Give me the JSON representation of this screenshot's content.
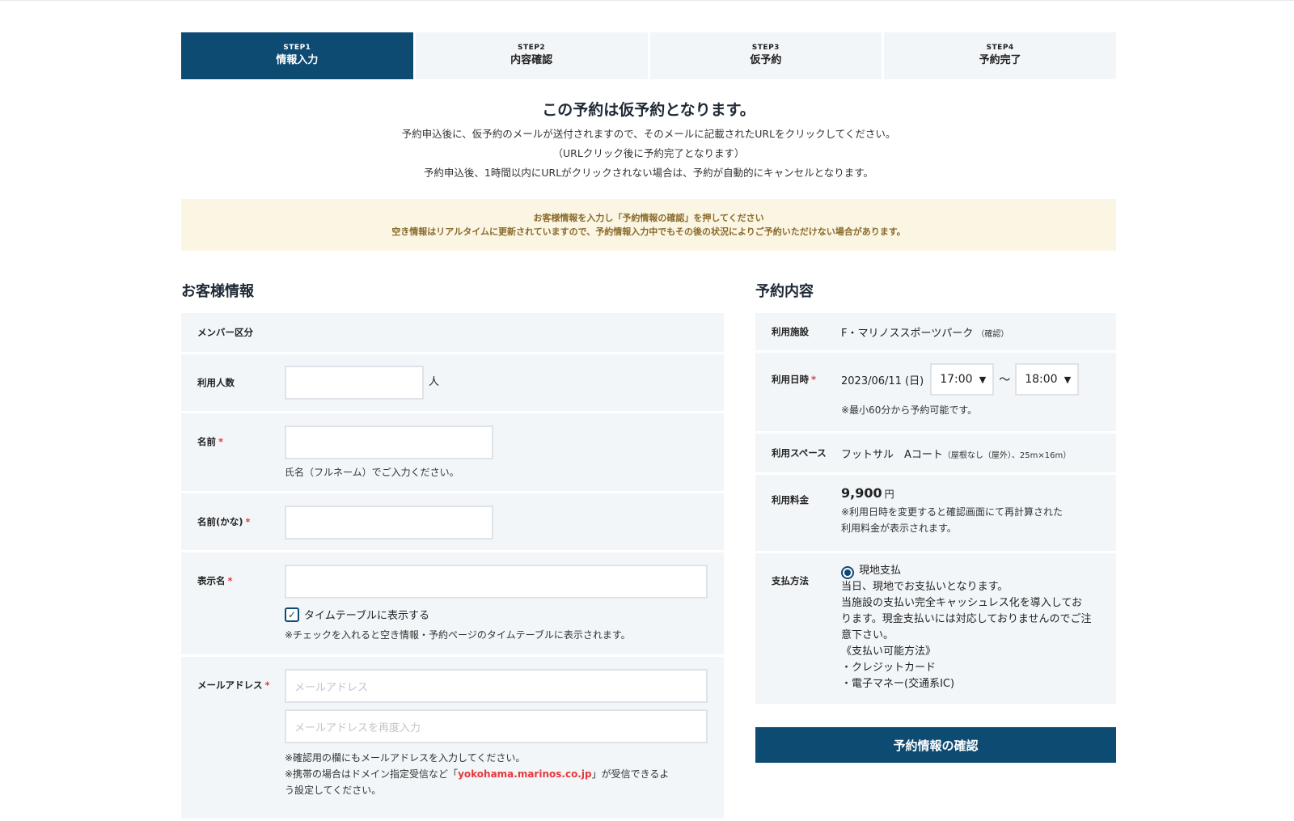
{
  "steps": [
    {
      "num": "STEP1",
      "label": "情報入力"
    },
    {
      "num": "STEP2",
      "label": "内容確認"
    },
    {
      "num": "STEP3",
      "label": "仮予約"
    },
    {
      "num": "STEP4",
      "label": "予約完了"
    }
  ],
  "notice": {
    "title": "この予約は仮予約となります。",
    "lines": [
      "予約申込後に、仮予約のメールが送付されますので、そのメールに記載されたURLをクリックしてください。",
      "（URLクリック後に予約完了となります）",
      "予約申込後、1時間以内にURLがクリックされない場合は、予約が自動的にキャンセルとなります。"
    ]
  },
  "warning": {
    "lines": [
      "お客様情報を入力し「予約情報の確認」を押してください",
      "空き情報はリアルタイムに更新されていますので、予約情報入力中でもその後の状況によりご予約いただけない場合があります。"
    ]
  },
  "customer": {
    "title": "お客様情報",
    "member_label": "メンバー区分",
    "people_label": "利用人数",
    "people_value": "",
    "people_unit": "人",
    "name_label": "名前",
    "name_value": "",
    "name_note": "氏名（フルネーム）でご入力ください。",
    "kana_label": "名前(かな)",
    "kana_value": "",
    "display_label": "表示名",
    "display_value": "",
    "timetable_checkbox": "タイムテーブルに表示する",
    "timetable_checked": true,
    "timetable_note": "※チェックを入れると空き情報・予約ページのタイムテーブルに表示されます。",
    "email_label": "メールアドレス",
    "email_placeholder": "メールアドレス",
    "email_confirm_placeholder": "メールアドレスを再度入力",
    "email_note1": "※確認用の欄にもメールアドレスを入力してください。",
    "email_note2_a": "※携帯の場合はドメイン指定受信など「",
    "email_note2_domain": "yokohama.marinos.co.jp",
    "email_note2_b": "」が受信できるよ",
    "email_note3": "う設定してください。",
    "required_mark": "*"
  },
  "reservation": {
    "title": "予約内容",
    "facility_label": "利用施設",
    "facility_value": "F・マリノススポーツパーク",
    "facility_link": "（確認）",
    "datetime_label": "利用日時",
    "date_value": "2023/06/11 (日)",
    "start_time": "17:00",
    "end_time": "18:00",
    "tilde": "〜",
    "datetime_note": "※最小60分から予約可能です。",
    "space_label": "利用スペース",
    "space_value": "フットサル　Aコート",
    "space_detail": "（屋根なし（屋外）、25m×16m）",
    "fee_label": "利用料金",
    "fee_value": "9,900",
    "fee_unit": "円",
    "fee_note1": "※利用日時を変更すると確認画面にて再計算された",
    "fee_note2": "利用料金が表示されます。",
    "payment_label": "支払方法",
    "payment_option": "現地支払",
    "payment_lines": [
      "当日、現地でお支払いとなります。",
      "当施設の支払い完全キャッシュレス化を導入してお",
      "ります。現金支払いには対応しておりませんのでご注",
      "意下さい。",
      "《支払い可能方法》",
      "・クレジットカード",
      "・電子マネー(交通系IC)"
    ]
  },
  "confirm_button": "予約情報の確認",
  "colors": {
    "primary": "#0e4b73",
    "required": "#e6383c",
    "row_bg": "#f2f6f9",
    "warning_bg": "#fbf6e3",
    "warning_text": "#8a6a2b"
  }
}
